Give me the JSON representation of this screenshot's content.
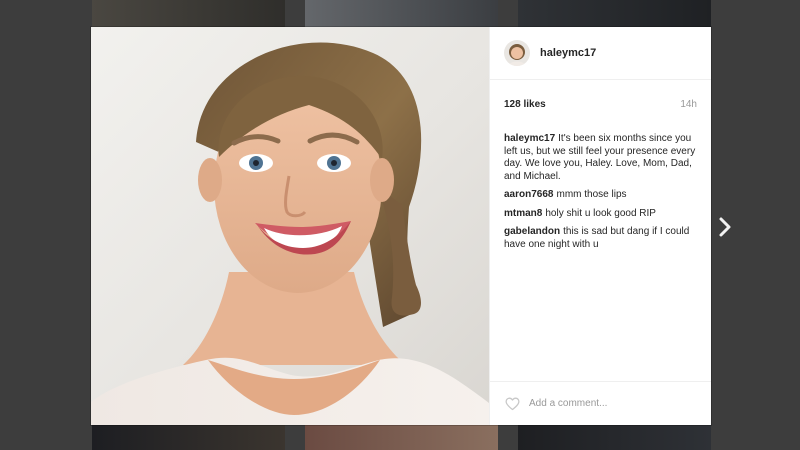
{
  "post": {
    "username": "haleymc17",
    "likes": "128 likes",
    "time": "14h",
    "comments": [
      {
        "author": "haleymc17",
        "text": "It's been six months since you left us, but we still feel your presence every day. We love you, Haley. Love, Mom, Dad, and Michael."
      },
      {
        "author": "aaron7668",
        "text": "mmm those lips"
      },
      {
        "author": "mtman8",
        "text": "holy shit u look good RIP"
      },
      {
        "author": "gabelandon",
        "text": "this is sad but dang if I could have one night with u"
      }
    ],
    "comment_placeholder": "Add a comment..."
  },
  "icons": {
    "like": "heart-icon",
    "next": "chevron-right-icon"
  },
  "colors": {
    "backdrop": "#3c3c3c",
    "text": "#262626",
    "muted": "#999999",
    "divider": "#efefef"
  }
}
